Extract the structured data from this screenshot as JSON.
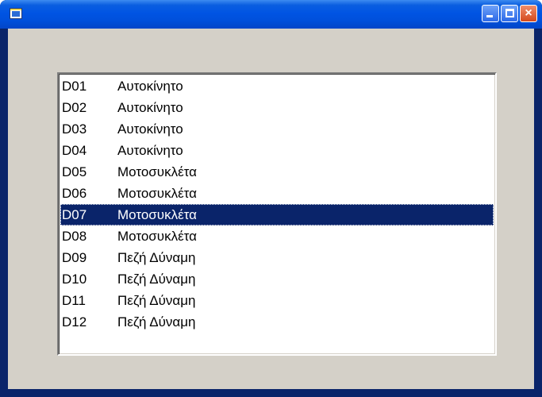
{
  "window": {
    "buttons": {
      "minimize": "minimize",
      "maximize": "maximize",
      "close": "×"
    }
  },
  "list": {
    "items": [
      {
        "code": "D01",
        "label": "Αυτοκίνητο",
        "selected": false
      },
      {
        "code": "D02",
        "label": "Αυτοκίνητο",
        "selected": false
      },
      {
        "code": "D03",
        "label": "Αυτοκίνητο",
        "selected": false
      },
      {
        "code": "D04",
        "label": "Αυτοκίνητο",
        "selected": false
      },
      {
        "code": "D05",
        "label": "Μοτοσυκλέτα",
        "selected": false
      },
      {
        "code": "D06",
        "label": "Μοτοσυκλέτα",
        "selected": false
      },
      {
        "code": "D07",
        "label": "Μοτοσυκλέτα",
        "selected": true
      },
      {
        "code": "D08",
        "label": "Μοτοσυκλέτα",
        "selected": false
      },
      {
        "code": "D09",
        "label": "Πεζή Δύναμη",
        "selected": false
      },
      {
        "code": "D10",
        "label": "Πεζή Δύναμη",
        "selected": false
      },
      {
        "code": "D11",
        "label": "Πεζή Δύναμη",
        "selected": false
      },
      {
        "code": "D12",
        "label": "Πεζή Δύναμη",
        "selected": false
      }
    ]
  },
  "colors": {
    "selection_bg": "#0a246a",
    "client_bg": "#d4d0c8",
    "titlebar": "#0054e3"
  },
  "icons": [
    "app-icon",
    "minimize-icon",
    "maximize-icon",
    "close-icon"
  ]
}
